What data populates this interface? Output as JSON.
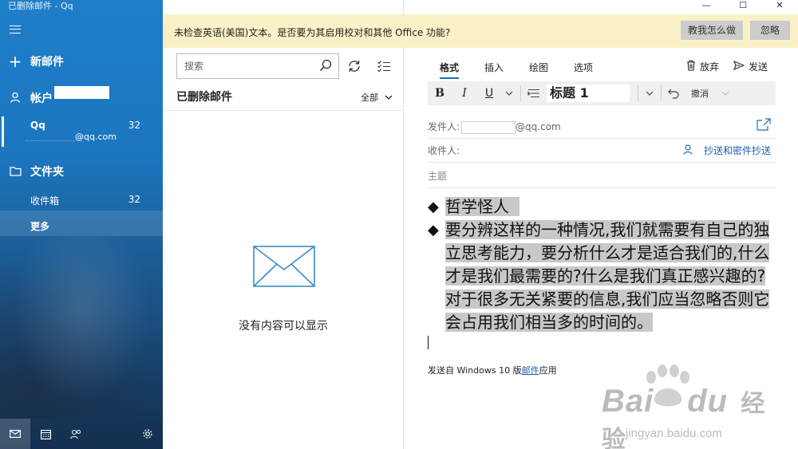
{
  "window": {
    "title": "已删除邮件 - Qq",
    "controls": [
      "—",
      "☐",
      "✕"
    ]
  },
  "sidebar": {
    "new_mail": "新邮件",
    "accounts_label": "帐户",
    "account_name": "Qq",
    "account_count": "32",
    "account_email_suffix": "@qq.com",
    "folders_label": "文件夹",
    "inbox_label": "收件箱",
    "inbox_count": "32",
    "more_label": "更多"
  },
  "list": {
    "search_placeholder": "搜索",
    "folder_title": "已删除邮件",
    "filter_label": "全部",
    "empty_text": "没有内容可以显示"
  },
  "infobar": {
    "message": "未检查英语(美国)文本。是否要为其启用校对和其他 Office 功能?",
    "teach_button": "教我怎么做",
    "ignore_button": "忽略"
  },
  "compose": {
    "tabs": [
      "格式",
      "插入",
      "绘图",
      "选项"
    ],
    "discard_label": "放弃",
    "send_label": "发送",
    "toolbar": {
      "bold": "B",
      "italic": "I",
      "underline": "U",
      "style_value": "标题 1",
      "undo_label": "撤消"
    },
    "from_label": "发件人:",
    "from_suffix": "@qq.com",
    "to_label": "收件人:",
    "cc_label": "抄送和密件抄送",
    "subject_placeholder": "主题",
    "body_line1": "哲学怪人",
    "body_line2": "要分辨这样的一种情况,我们就需要有自己的独立思考能力，要分析什么才是适合我们的,什么才是我们最需要的?什么是我们真正感兴趣的?对于很多无关紧要的信息,我们应当忽略否则它会占用我们相当多的时间的。",
    "signature_prefix": "发送自 Windows 10 版",
    "signature_link": "邮件",
    "signature_suffix": "应用"
  },
  "watermark": {
    "brand": "Bai",
    "brand2": "du",
    "product": "经验",
    "url": "jingyan.baidu.com"
  },
  "colors": {
    "sidebar_blue": "#1f7ec9",
    "infobar_yellow": "#fbf1c7",
    "highlight_gray": "#c8c8c8",
    "accent": "#1c6fb3"
  }
}
